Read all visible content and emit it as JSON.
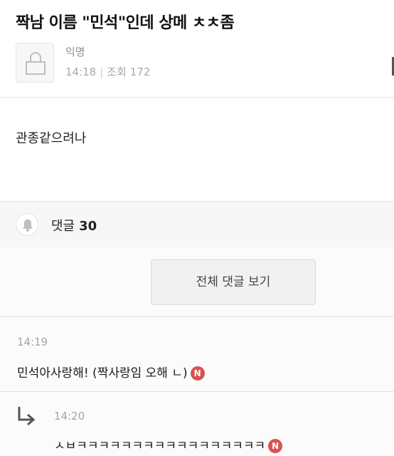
{
  "post": {
    "title": "짝남 이름 \"민석\"인데 상메 ㅊㅊ좀",
    "author": "익명",
    "time": "14:18",
    "views_label": "조회",
    "views": "172",
    "body": "관종같으려나"
  },
  "comments_header": {
    "label": "댓글",
    "count": "30"
  },
  "view_all_label": "전체 댓글 보기",
  "comments": [
    {
      "time": "14:19",
      "text": "민석아사랑해! (짝사랑임 오해 ㄴ)",
      "badge": "N"
    },
    {
      "time": "14:20",
      "text": "ㅅㅂㅋㅋㅋㅋㅋㅋㅋㅋㅋㅋㅋㅋㅋㅋㅋㅋㅋ",
      "badge": "N",
      "is_reply": true
    }
  ],
  "colors": {
    "badge": "#d9534f",
    "muted_text": "#a9a9a9",
    "comments_bar_bg": "#f7f7f7"
  },
  "icons": [
    "lock-icon",
    "bell-icon",
    "reply-arrow-icon"
  ]
}
